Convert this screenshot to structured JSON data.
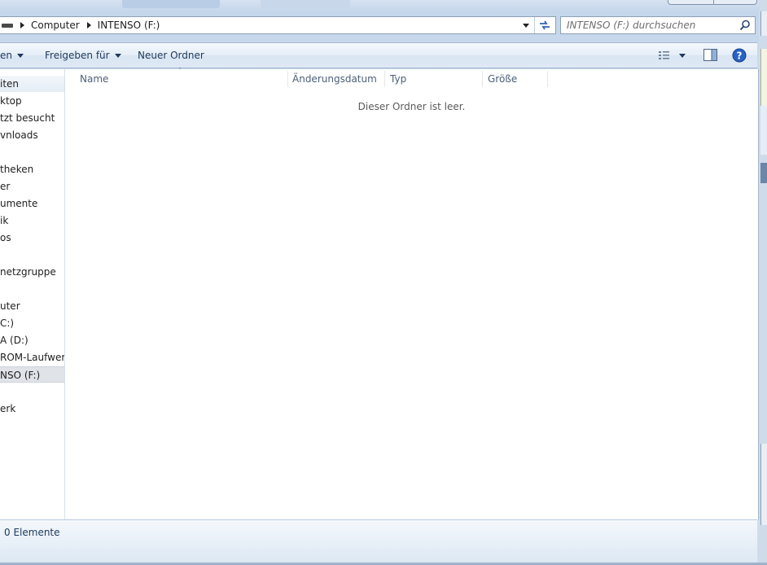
{
  "address": {
    "breadcrumbs": [
      "Computer",
      "INTENSO (F:)"
    ]
  },
  "search": {
    "placeholder": "INTENSO (F:) durchsuchen"
  },
  "toolbar": {
    "organize_label": "en",
    "share_label": "Freigeben für",
    "new_folder_label": "Neuer Ordner"
  },
  "navigation": {
    "items": [
      {
        "label": "iten"
      },
      {
        "label": "ktop"
      },
      {
        "label": "tzt besucht"
      },
      {
        "label": "vnloads"
      },
      {
        "label": "theken"
      },
      {
        "label": "er"
      },
      {
        "label": "umente"
      },
      {
        "label": "ik"
      },
      {
        "label": "os"
      },
      {
        "label": "netzgruppe"
      },
      {
        "label": "uter"
      },
      {
        "label": "C:)"
      },
      {
        "label": "A (D:)"
      },
      {
        "label": "ROM-Laufwerk"
      },
      {
        "label": "NSO (F:)"
      },
      {
        "label": "erk"
      }
    ]
  },
  "content": {
    "columns": [
      "Name",
      "Änderungsdatum",
      "Typ",
      "Größe"
    ],
    "empty_message": "Dieser Ordner ist leer."
  },
  "status": {
    "item_count": "0 Elemente"
  },
  "colors": {
    "accent": "#1e395b",
    "help_blue": "#2a63c2"
  }
}
